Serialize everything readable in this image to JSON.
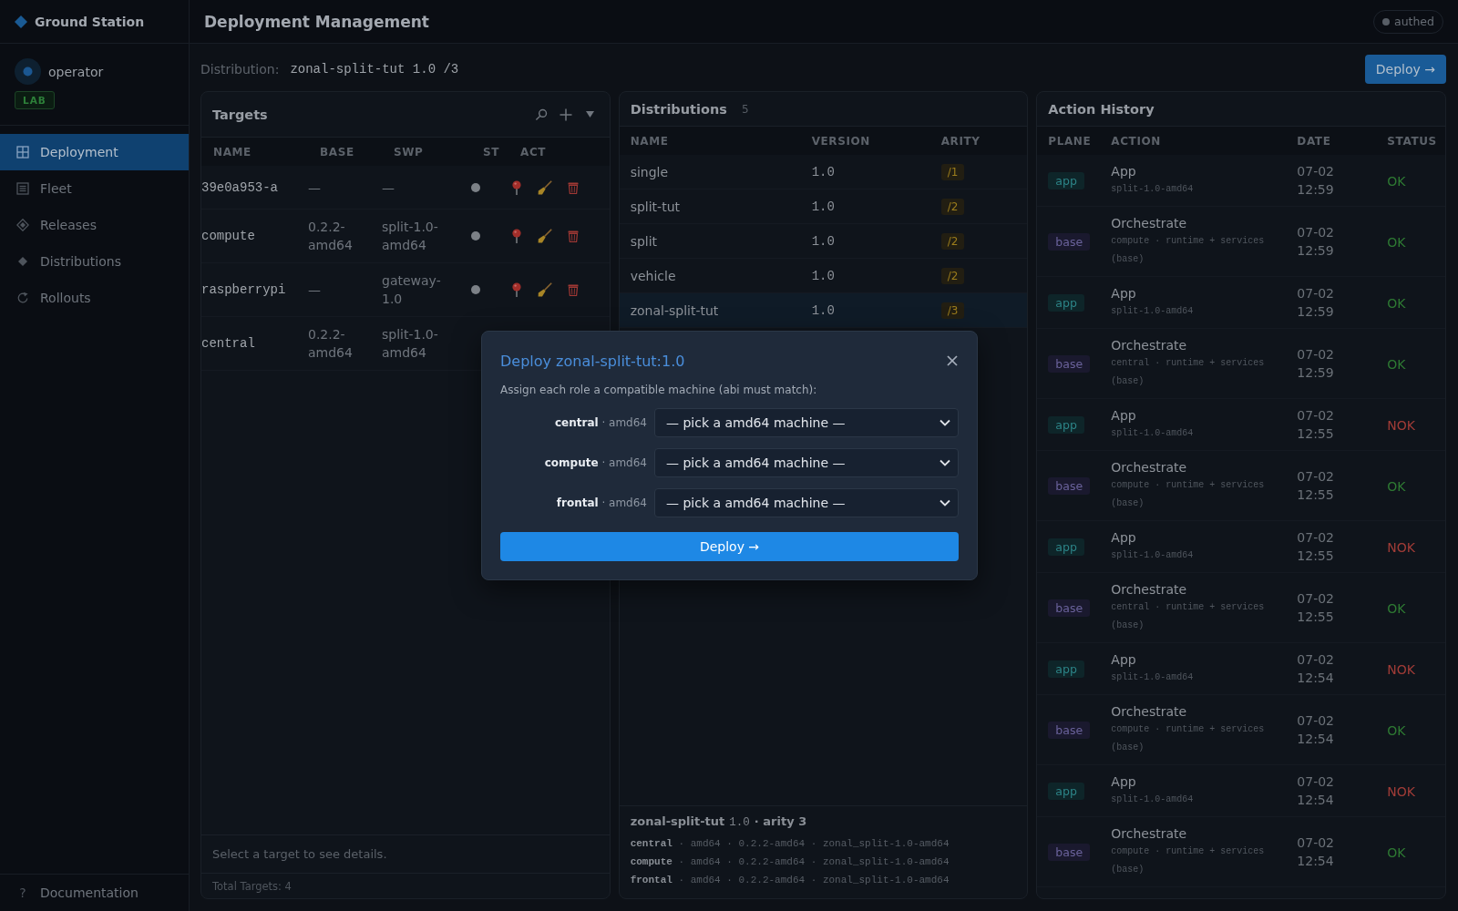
{
  "sidebar": {
    "brand": "Ground Station",
    "user": {
      "name": "operator",
      "badge": "LAB"
    },
    "nav": [
      {
        "label": "Deployment",
        "selected": true
      },
      {
        "label": "Fleet",
        "selected": false
      },
      {
        "label": "Releases",
        "selected": false
      },
      {
        "label": "Distributions",
        "selected": false
      },
      {
        "label": "Rollouts",
        "selected": false
      }
    ],
    "footer_link": {
      "glyph": "?",
      "label": "Documentation"
    }
  },
  "header": {
    "title": "Deployment Management",
    "auth": "authed"
  },
  "toolbar": {
    "label": "Distribution:",
    "value": "zonal-split-tut 1.0 /3",
    "button": "Deploy →"
  },
  "targets": {
    "title": "Targets",
    "columns": [
      "NAME",
      "BASE",
      "SWP",
      "ST",
      "ACT"
    ],
    "rows": [
      {
        "name": "39e0a953-a",
        "base": "—",
        "swp": "—",
        "online": false
      },
      {
        "name": "compute",
        "base": "0.2.2-amd64",
        "swp": "split-1.0-amd64",
        "online": false
      },
      {
        "name": "raspberrypi",
        "base": "—",
        "swp": "gateway-1.0",
        "online": false
      },
      {
        "name": "central",
        "base": "0.2.2-amd64",
        "swp": "split-1.0-amd64"
      }
    ],
    "detail_hint": "Select a target to see details.",
    "total": "Total Targets: 4"
  },
  "distributions": {
    "title": "Distributions",
    "count": "5",
    "columns": [
      "NAME",
      "VERSION",
      "ARITY"
    ],
    "rows": [
      {
        "name": "single",
        "version": "1.0",
        "arity": "/1",
        "selected": false
      },
      {
        "name": "split-tut",
        "version": "1.0",
        "arity": "/2",
        "selected": false
      },
      {
        "name": "split",
        "version": "1.0",
        "arity": "/2",
        "selected": false
      },
      {
        "name": "vehicle",
        "version": "1.0",
        "arity": "/2",
        "selected": false
      },
      {
        "name": "zonal-split-tut",
        "version": "1.0",
        "arity": "/3",
        "selected": true
      }
    ],
    "summary": {
      "name": "zonal-split-tut",
      "version": "1.0",
      "arity": "· arity 3",
      "roles": [
        "**central** · amd64 · 0.2.2-amd64 · zonal_split-1.0-amd64",
        "**compute** · amd64 · 0.2.2-amd64 · zonal_split-1.0-amd64",
        "**frontal** · amd64 · 0.2.2-amd64 · zonal_split-1.0-amd64"
      ]
    }
  },
  "history": {
    "title": "Action History",
    "columns": [
      "PLANE",
      "ACTION",
      "DATE",
      "STATUS"
    ],
    "rows": [
      {
        "plane": "app",
        "kind": "app",
        "action": "App",
        "detail": "split-1.0-amd64",
        "date": "07-02 12:59",
        "status": "OK",
        "ok": true
      },
      {
        "plane": "base",
        "kind": "base",
        "action": "Orchestrate",
        "detail": "compute · runtime + services (base)",
        "date": "07-02 12:59",
        "status": "OK",
        "ok": true
      },
      {
        "plane": "app",
        "kind": "app",
        "action": "App",
        "detail": "split-1.0-amd64",
        "date": "07-02 12:59",
        "status": "OK",
        "ok": true
      },
      {
        "plane": "base",
        "kind": "base",
        "action": "Orchestrate",
        "detail": "central · runtime + services (base)",
        "date": "07-02 12:59",
        "status": "OK",
        "ok": true
      },
      {
        "plane": "app",
        "kind": "app",
        "action": "App",
        "detail": "split-1.0-amd64",
        "date": "07-02 12:55",
        "status": "NOK",
        "ok": false
      },
      {
        "plane": "base",
        "kind": "base",
        "action": "Orchestrate",
        "detail": "compute · runtime + services (base)",
        "date": "07-02 12:55",
        "status": "OK",
        "ok": true
      },
      {
        "plane": "app",
        "kind": "app",
        "action": "App",
        "detail": "split-1.0-amd64",
        "date": "07-02 12:55",
        "status": "NOK",
        "ok": false
      },
      {
        "plane": "base",
        "kind": "base",
        "action": "Orchestrate",
        "detail": "central · runtime + services (base)",
        "date": "07-02 12:55",
        "status": "OK",
        "ok": true
      },
      {
        "plane": "app",
        "kind": "app",
        "action": "App",
        "detail": "split-1.0-amd64",
        "date": "07-02 12:54",
        "status": "NOK",
        "ok": false
      },
      {
        "plane": "base",
        "kind": "base",
        "action": "Orchestrate",
        "detail": "compute · runtime + services (base)",
        "date": "07-02 12:54",
        "status": "OK",
        "ok": true
      },
      {
        "plane": "app",
        "kind": "app",
        "action": "App",
        "detail": "split-1.0-amd64",
        "date": "07-02 12:54",
        "status": "NOK",
        "ok": false
      },
      {
        "plane": "base",
        "kind": "base",
        "action": "Orchestrate",
        "detail": "compute · runtime + services (base)",
        "date": "07-02 12:54",
        "status": "OK",
        "ok": true
      }
    ]
  },
  "modal": {
    "title": "Deploy zonal-split-tut:1.0",
    "description": "Assign each role a compatible machine (abi must match):",
    "roles": [
      {
        "label": "**central** · amd64",
        "value": "— pick a amd64 machine —"
      },
      {
        "label": "**compute** · amd64",
        "value": "— pick a amd64 machine —"
      },
      {
        "label": "**frontal** · amd64",
        "value": "— pick a amd64 machine —"
      }
    ],
    "button": "Deploy →"
  }
}
